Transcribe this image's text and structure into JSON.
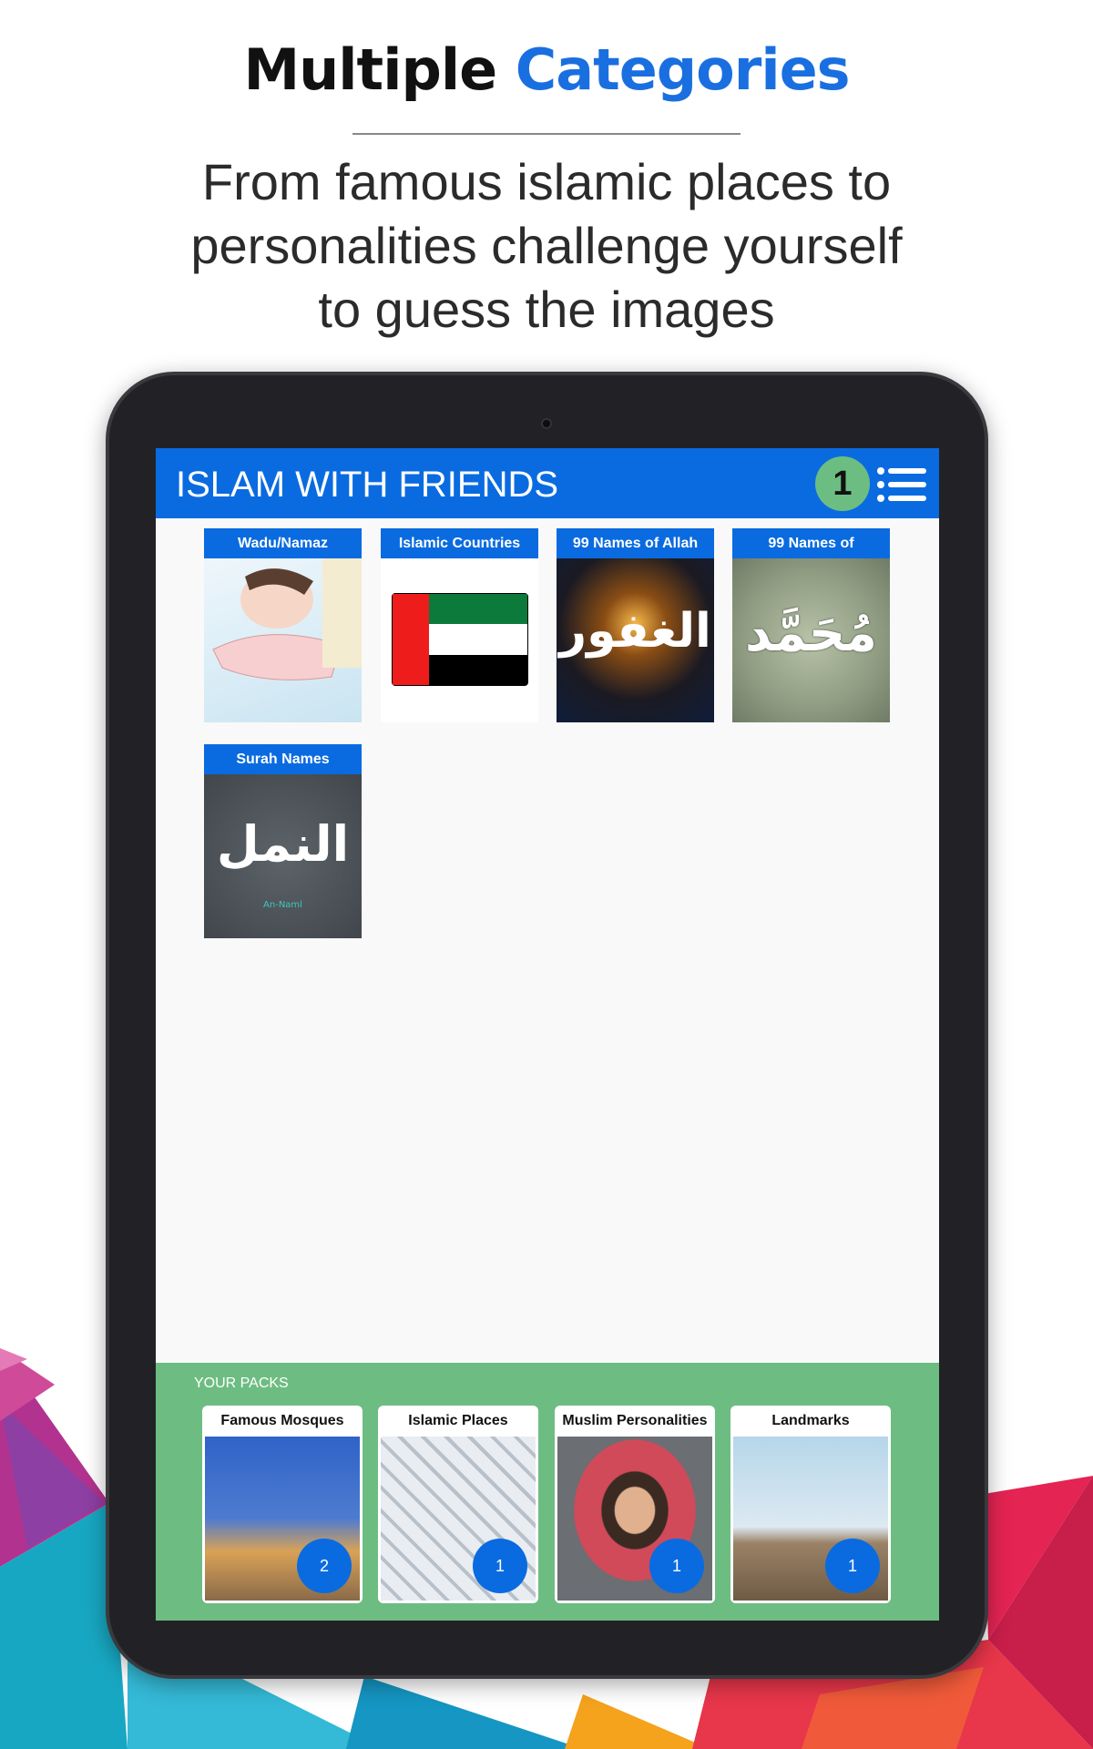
{
  "headline": {
    "part1": "Multiple",
    "part2": "Categories"
  },
  "subtitle": [
    "From famous islamic places to",
    "personalities challenge yourself",
    "to guess the images"
  ],
  "colors": {
    "accent": "#1a6fe0",
    "appbar": "#0a6be0",
    "packs_bg": "#6dbd82",
    "badge": "#6cbd82"
  },
  "app": {
    "title": "ISLAM WITH FRIENDS",
    "badge_count": "1",
    "menu_icon": "list-menu-icon"
  },
  "categories": [
    {
      "label": "Wadu/Namaz",
      "image": "wudu-illustration"
    },
    {
      "label": "Islamic Countries",
      "image": "uae-flag"
    },
    {
      "label": "99 Names of Allah",
      "image": "calligraphy",
      "calligraphy": "الغفور"
    },
    {
      "label": "99 Names of",
      "image": "calligraphy",
      "calligraphy": "مُحَمَّد"
    },
    {
      "label": "Surah Names",
      "image": "calligraphy",
      "calligraphy": "النمل",
      "caption": "An-Naml"
    }
  ],
  "packs": {
    "title": "YOUR PACKS",
    "items": [
      {
        "label": "Famous Mosques",
        "count": "2",
        "image": "blue-mosque"
      },
      {
        "label": "Islamic Places",
        "count": "1",
        "image": "mina-tents"
      },
      {
        "label": "Muslim Personalities",
        "count": "1",
        "image": "imam-portrait"
      },
      {
        "label": "Landmarks",
        "count": "1",
        "image": "jabal-rahmah"
      }
    ]
  }
}
